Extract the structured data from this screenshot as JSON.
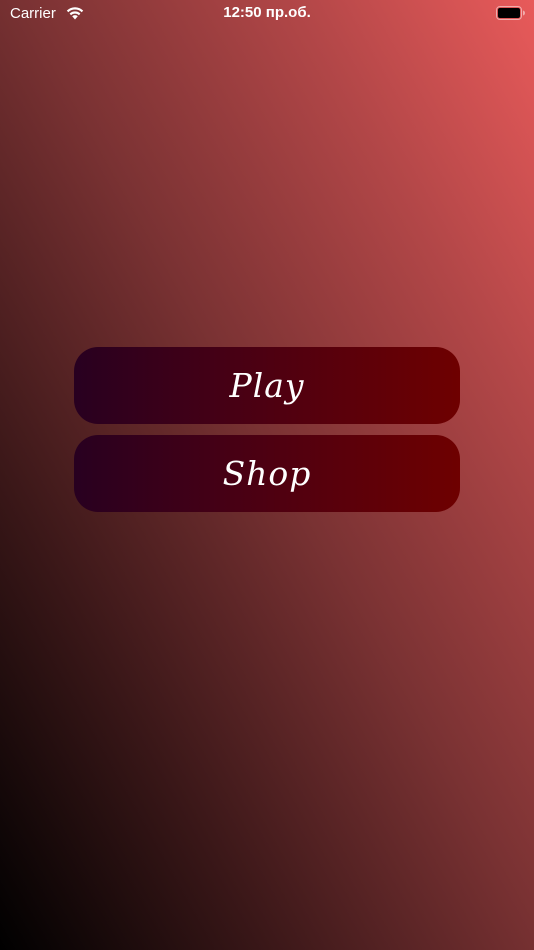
{
  "status_bar": {
    "carrier": "Carrier",
    "time": "12:50 пр.об.",
    "wifi_icon": "wifi-icon",
    "battery_icon": "battery-icon"
  },
  "menu": {
    "play_label": "Play",
    "shop_label": "Shop"
  },
  "colors": {
    "background_gradient": [
      "#000000",
      "#3a1718",
      "#7a3233",
      "#b34748",
      "#e85a5a"
    ],
    "button_gradient": [
      "#280020",
      "#4a0013",
      "#6e0000"
    ],
    "button_text": "#ffffff"
  }
}
